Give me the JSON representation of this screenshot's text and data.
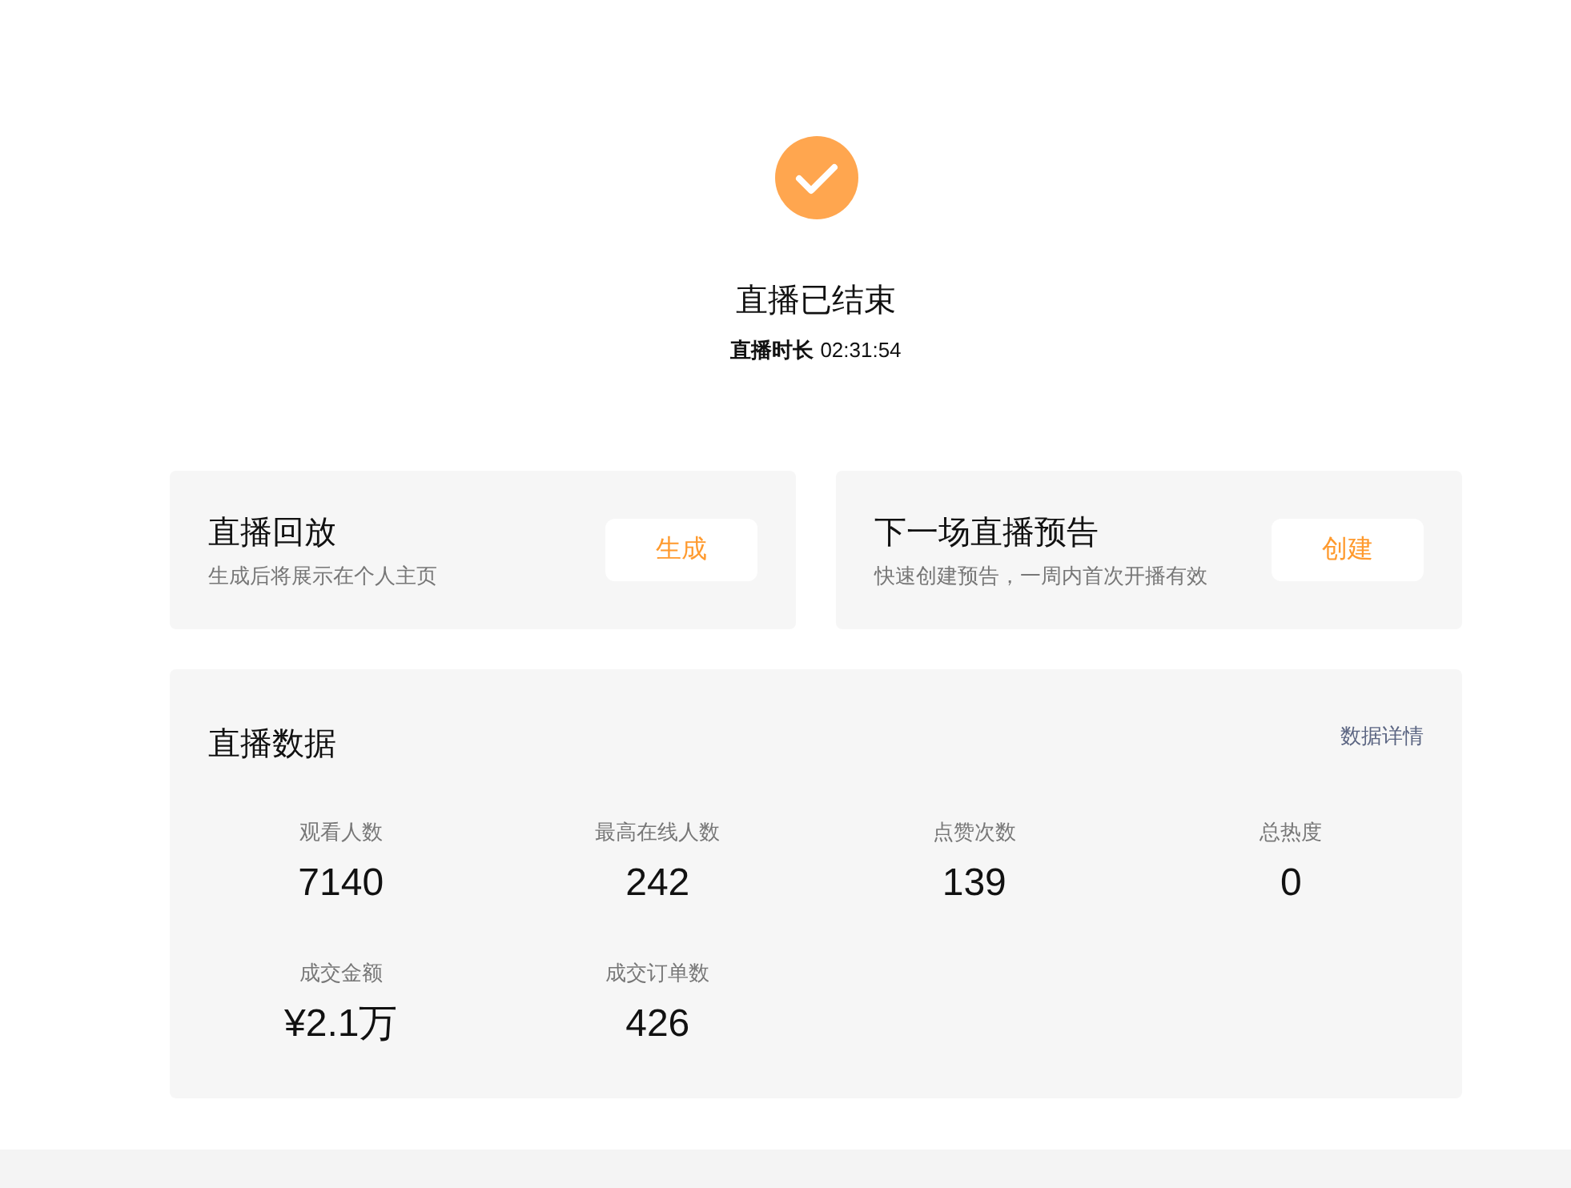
{
  "status": {
    "title": "直播已结束",
    "duration": {
      "label": "直播时长",
      "value": "02:31:54"
    }
  },
  "actions": [
    {
      "title": "直播回放",
      "subtitle": "生成后将展示在个人主页",
      "button": "生成"
    },
    {
      "title": "下一场直播预告",
      "subtitle": "快速创建预告，一周内首次开播有效",
      "button": "创建"
    }
  ],
  "live_data": {
    "title": "直播数据",
    "details_link": "数据详情",
    "metrics": [
      {
        "label": "观看人数",
        "value": "7140"
      },
      {
        "label": "最高在线人数",
        "value": "242"
      },
      {
        "label": "点赞次数",
        "value": "139"
      },
      {
        "label": "总热度",
        "value": "0"
      },
      {
        "label": "成交金额",
        "value": "¥2.1万"
      },
      {
        "label": "成交订单数",
        "value": "426"
      }
    ]
  }
}
